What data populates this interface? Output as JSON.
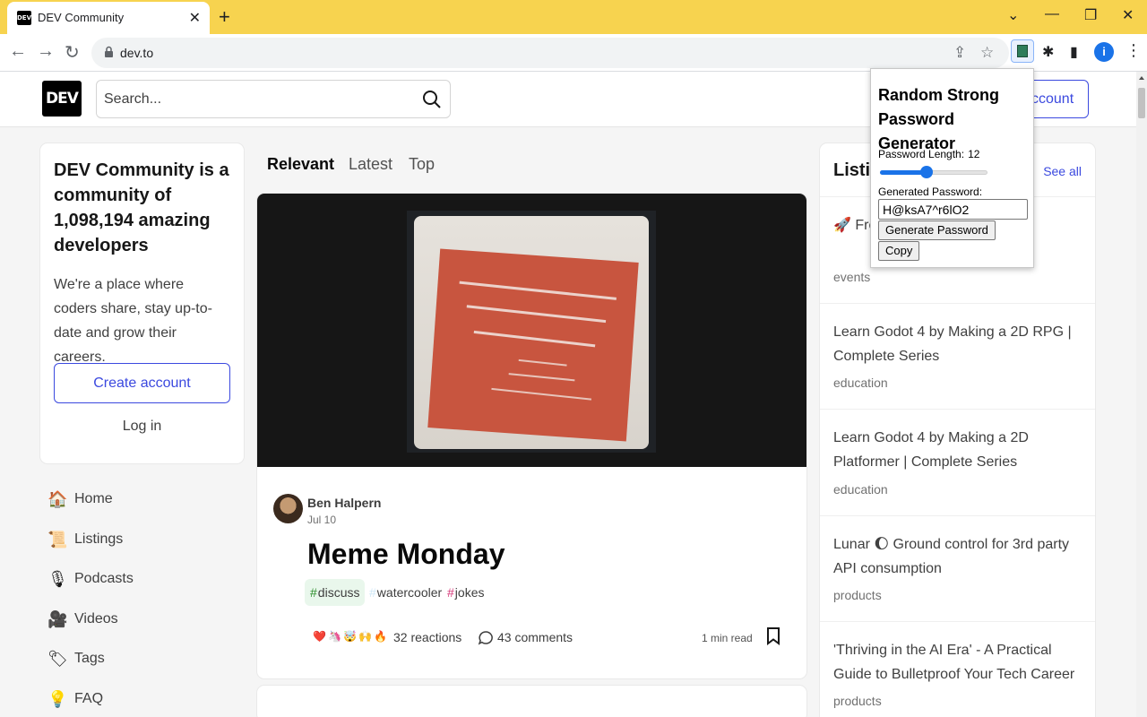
{
  "browser": {
    "tab_title": "DEV Community",
    "favicon_text": "DEV",
    "url": "dev.to"
  },
  "header": {
    "logo_text": "DEV",
    "search_placeholder": "Search...",
    "create_account_partial": "ccount"
  },
  "intro": {
    "title": "DEV Community is a community of 1,098,194 amazing developers",
    "description": "We're a place where coders share, stay up-to-date and grow their careers.",
    "create_account": "Create account",
    "login": "Log in"
  },
  "side_nav": [
    {
      "icon": "house-icon",
      "emoji": "🏠",
      "label": "Home"
    },
    {
      "icon": "scroll-icon",
      "emoji": "📜",
      "label": "Listings"
    },
    {
      "icon": "microphone-icon",
      "emoji": "🎙",
      "label": "Podcasts"
    },
    {
      "icon": "video-camera-icon",
      "emoji": "🎥",
      "label": "Videos"
    },
    {
      "icon": "tag-icon",
      "emoji": "🏷",
      "label": "Tags"
    },
    {
      "icon": "lightbulb-icon",
      "emoji": "💡",
      "label": "FAQ"
    }
  ],
  "feed": {
    "tabs": [
      "Relevant",
      "Latest",
      "Top"
    ],
    "active_tab": "Relevant"
  },
  "post": {
    "author": "Ben Halpern",
    "date": "Jul 10",
    "title": "Meme Monday",
    "tags": [
      {
        "name": "discuss",
        "hash_color": "#2d8f2d",
        "bg": "#e9f7ec"
      },
      {
        "name": "watercooler",
        "hash_color": "#cfe8f7",
        "bg": "transparent"
      },
      {
        "name": "jokes",
        "hash_color": "#d63b7a",
        "bg": "transparent"
      }
    ],
    "reaction_emojis": [
      "❤️",
      "🦄",
      "🤯",
      "🙌",
      "🔥"
    ],
    "reactions": "32 reactions",
    "comments": "43 comments",
    "read_time": "1 min read"
  },
  "listings": {
    "title": "Listi",
    "see_all": "See all",
    "items": [
      {
        "title": "🚀 Fre Applic",
        "category": "events"
      },
      {
        "title": "Learn Godot 4 by Making a 2D RPG | Complete Series",
        "category": "education"
      },
      {
        "title": "Learn Godot 4 by Making a 2D Platformer | Complete Series",
        "category": "education"
      },
      {
        "title": "Lunar 🌔 Ground control for 3rd party API consumption",
        "category": "products"
      },
      {
        "title": "'Thriving in the AI Era' - A Practical Guide to Bulletproof Your Tech Career",
        "category": "products"
      }
    ]
  },
  "extension": {
    "title": "Random Strong Password Generator",
    "length_label": "Password Length:",
    "length_value": "12",
    "length_fraction": 0.42,
    "generated_label": "Generated Password:",
    "generated_value": "H@ksA7^r6lO2",
    "generate_button": "Generate Password",
    "copy_button": "Copy"
  }
}
